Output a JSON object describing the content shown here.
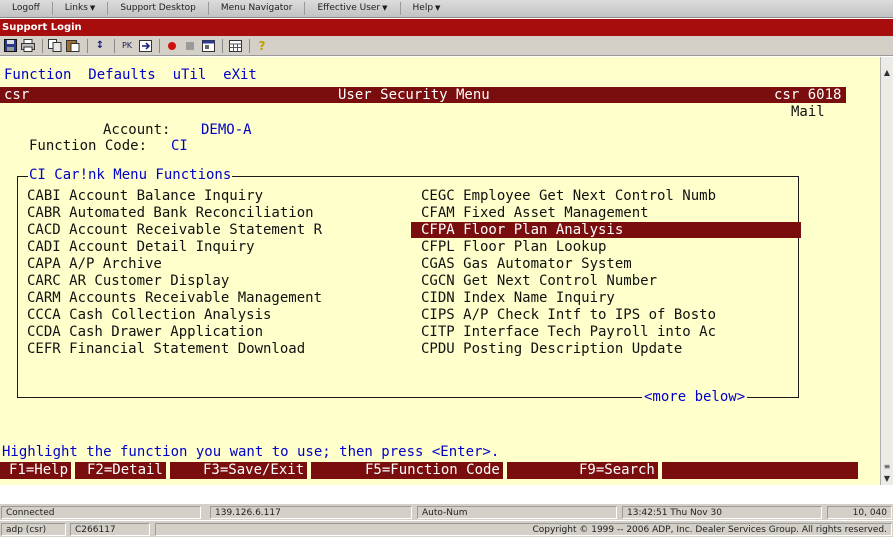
{
  "top_menu": {
    "items": [
      "Logoff",
      "Links",
      "Support Desktop",
      "Menu Navigator",
      "Effective User",
      "Help"
    ]
  },
  "window_title": "Support Login",
  "toolbar": {
    "icons": [
      "save-icon",
      "print-icon",
      "copy-icon",
      "paste-icon",
      "sort-icon",
      "pk-icon",
      "export-icon",
      "record-icon",
      "stop-icon",
      "window-icon",
      "calendar-icon",
      "help-icon"
    ],
    "pk_label": "PK"
  },
  "terminal": {
    "function_menu": "Function  Defaults  uTil  eXit",
    "header": {
      "left": "csr",
      "title": "User Security Menu",
      "right": "csr 6018"
    },
    "mail_label": "Mail",
    "account_label": "Account:",
    "account_value": "DEMO-A",
    "function_code_label": "Function Code:",
    "function_code_value": "CI",
    "box_title": "CI Car!nk Menu Functions",
    "left_functions": [
      "CABI Account Balance Inquiry",
      "CABR Automated Bank Reconciliation",
      "CACD Account Receivable Statement R",
      "CADI Account Detail Inquiry",
      "CAPA A/P Archive",
      "CARC AR Customer Display",
      "CARM Accounts Receivable Management",
      "CCCA Cash Collection Analysis",
      "CCDA Cash Drawer Application",
      "CEFR Financial Statement Download"
    ],
    "right_functions": [
      "CEGC Employee Get Next Control Numb",
      "CFAM Fixed Asset Management",
      "CFPA Floor Plan Analysis",
      "CFPL Floor Plan Lookup",
      "CGAS Gas Automator System",
      "CGCN Get Next Control Number",
      "CIDN Index Name Inquiry",
      "CIPS A/P Check Intf to IPS of Bosto",
      "CITP Interface Tech Payroll into Ac",
      "CPDU Posting Description Update"
    ],
    "selected_function": "CFPA Floor Plan Analysis",
    "more_below": "<more below>",
    "instruction": "Highlight the function you want to use; then press <Enter>.",
    "fkeys": [
      "F1=Help",
      "F2=Detail",
      "F3=Save/Exit",
      "F5=Function Code",
      "F9=Search"
    ]
  },
  "status_bar": {
    "connection": "Connected",
    "ip": "139.126.6.117",
    "mode": "Auto-Num",
    "datetime": "13:42:51  Thu Nov 30",
    "position": "10, 040"
  },
  "footer": {
    "user": "adp (csr)",
    "session": "C266117",
    "copyright": "Copyright © 1999 -- 2006 ADP, Inc. Dealer Services Group. All rights reserved."
  },
  "colors": {
    "terminal_bg": "#ffffcc",
    "accent_red": "#7a0d0d",
    "title_red": "#a80d0d",
    "terminal_blue": "#0000c8"
  }
}
